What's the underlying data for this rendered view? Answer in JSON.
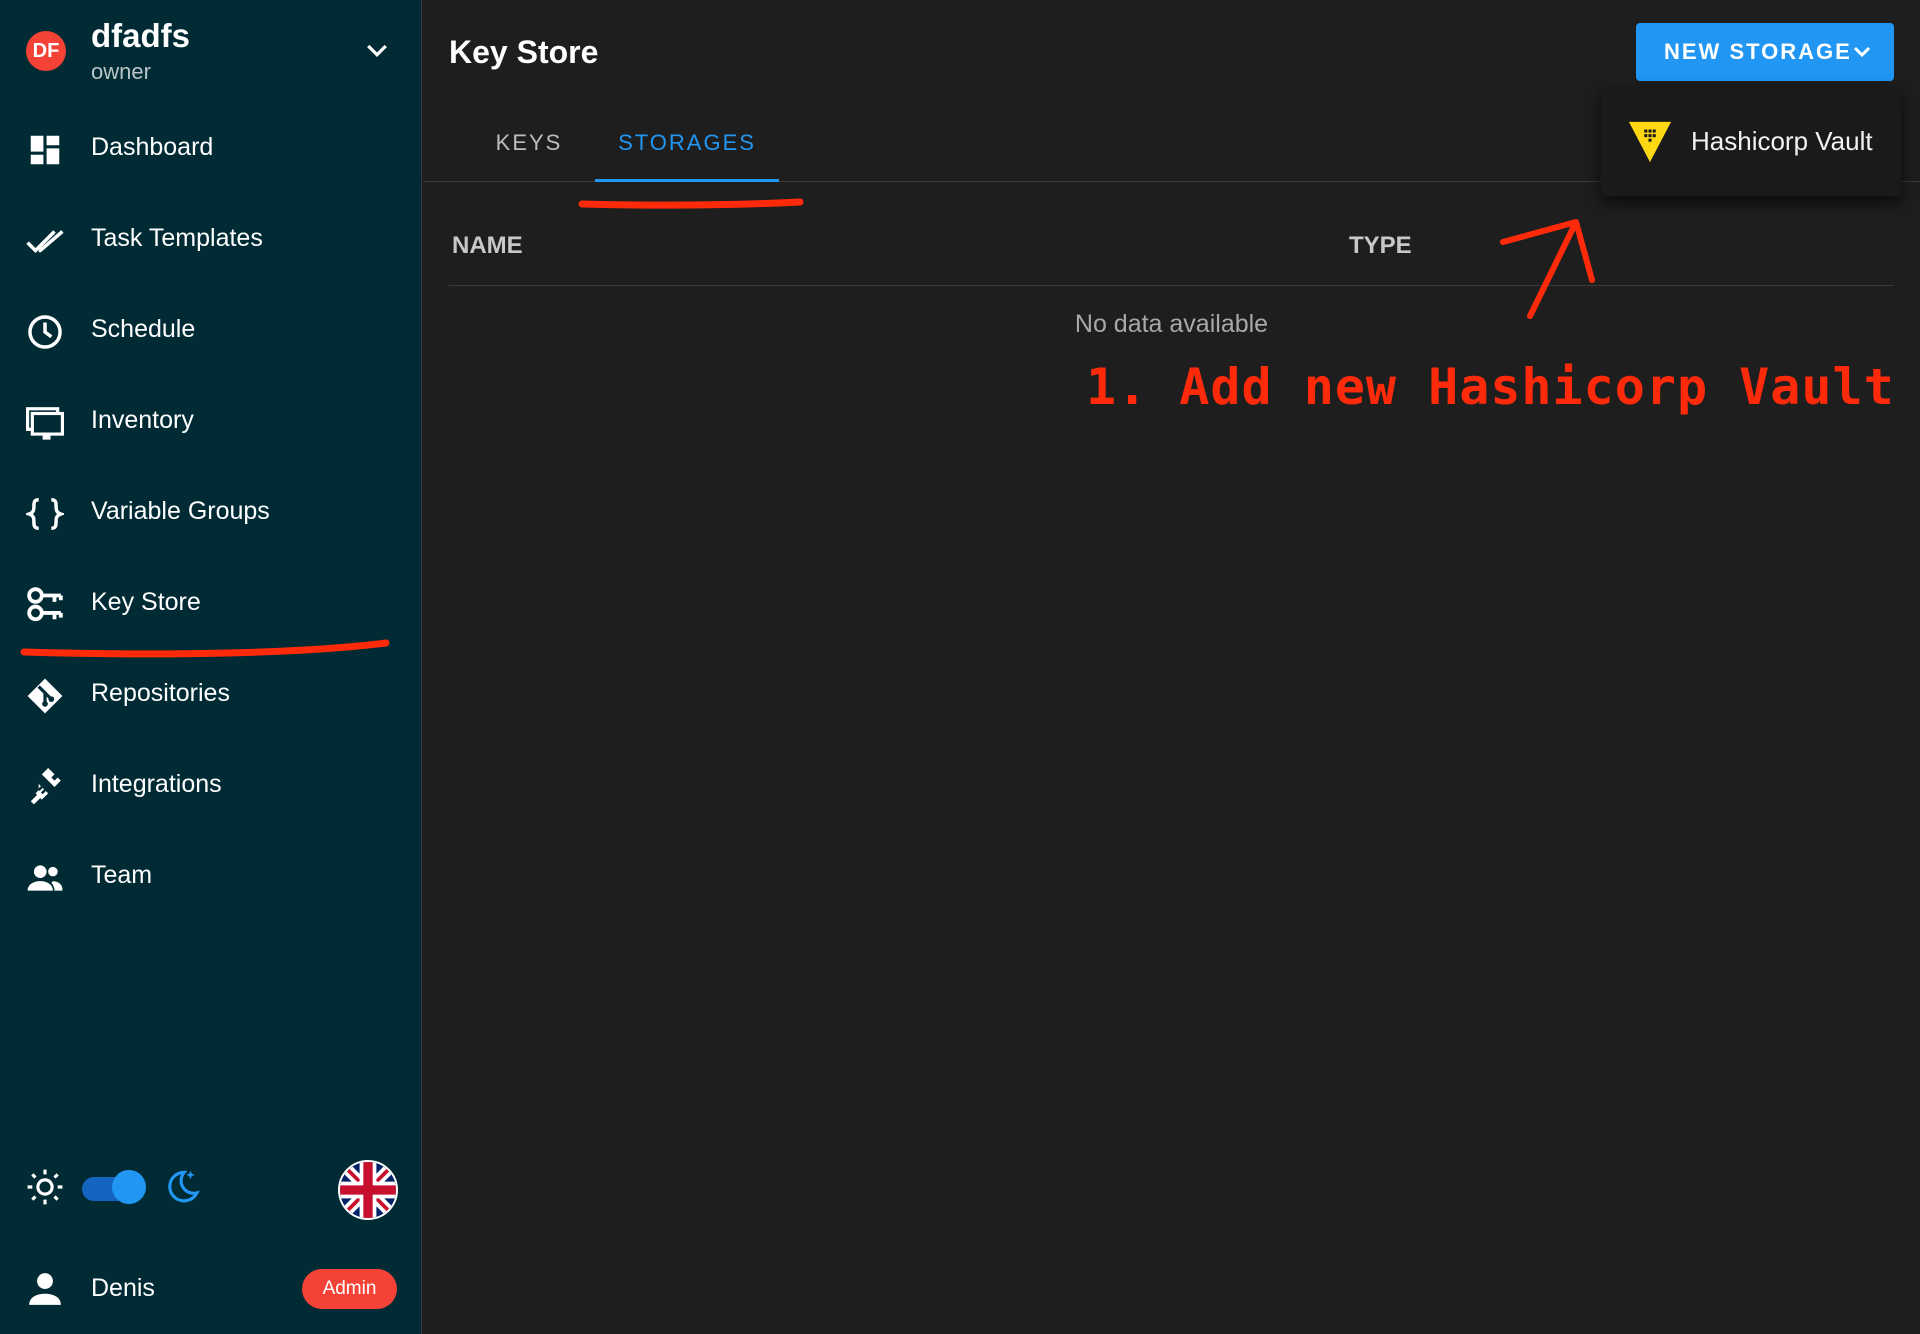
{
  "project": {
    "avatar_initials": "DF",
    "name": "dfadfs",
    "role": "owner"
  },
  "sidebar": {
    "items": [
      {
        "label": "Dashboard",
        "icon": "dashboard-icon"
      },
      {
        "label": "Task Templates",
        "icon": "double-check-icon"
      },
      {
        "label": "Schedule",
        "icon": "clock-icon"
      },
      {
        "label": "Inventory",
        "icon": "monitor-icon"
      },
      {
        "label": "Variable Groups",
        "icon": "braces-icon"
      },
      {
        "label": "Key Store",
        "icon": "key-icon"
      },
      {
        "label": "Repositories",
        "icon": "git-icon"
      },
      {
        "label": "Integrations",
        "icon": "plug-icon"
      },
      {
        "label": "Team",
        "icon": "team-icon"
      }
    ],
    "theme": {
      "dark_mode": true
    },
    "language_flag": "uk-flag-icon",
    "user": {
      "name": "Denis",
      "badge": "Admin"
    }
  },
  "main": {
    "title": "Key Store",
    "new_storage_label": "NEW STORAGE",
    "tabs": [
      {
        "label": "KEYS",
        "active": false
      },
      {
        "label": "STORAGES",
        "active": true
      }
    ],
    "table": {
      "columns": [
        "NAME",
        "TYPE"
      ],
      "empty_text": "No data available"
    },
    "dropdown": {
      "items": [
        {
          "label": "Hashicorp Vault",
          "icon": "vault-icon"
        }
      ]
    }
  },
  "annotation": {
    "text": "1. Add new Hashicorp Vault",
    "color": "#ff2a0a"
  },
  "colors": {
    "accent": "#2196f3",
    "sidebar_bg": "#012b34",
    "main_bg": "#1e1e1e",
    "danger": "#f44336",
    "vault_yellow": "#ffd814"
  }
}
